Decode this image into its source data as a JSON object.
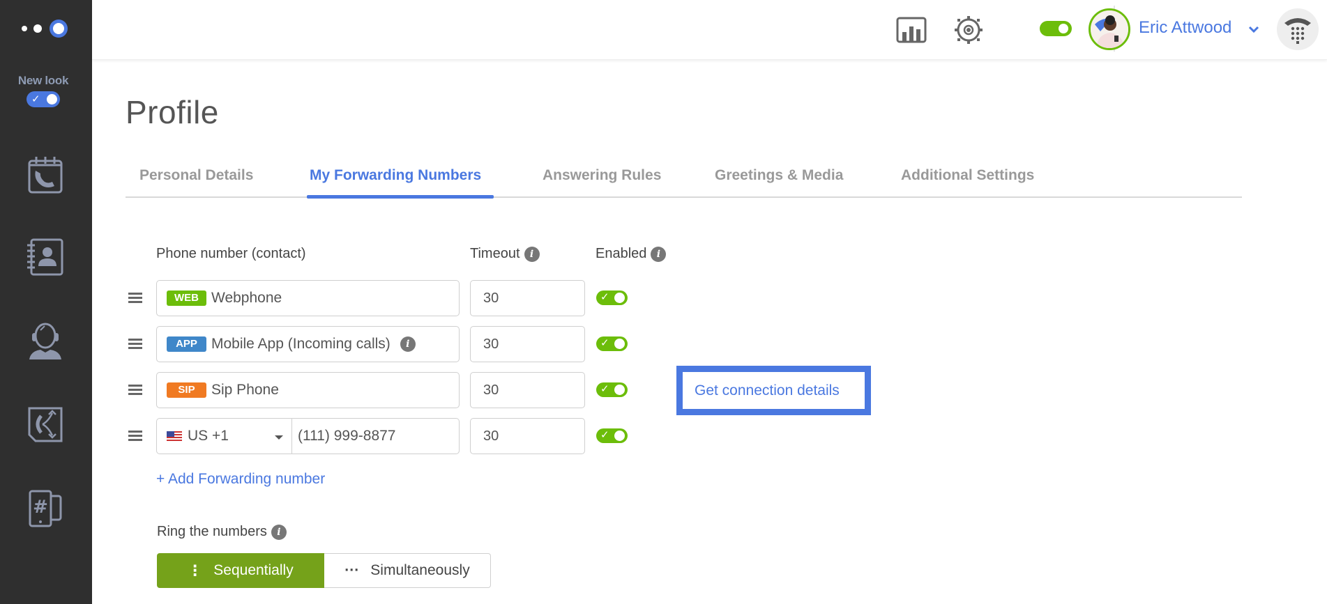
{
  "sidebar": {
    "new_look_label": "New look",
    "new_look_enabled": true,
    "items": [
      {
        "name": "call-history",
        "icon": "calendar-phone-icon"
      },
      {
        "name": "contacts",
        "icon": "address-book-icon"
      },
      {
        "name": "call-center",
        "icon": "headset-agent-icon"
      },
      {
        "name": "call-flow",
        "icon": "call-routing-icon"
      },
      {
        "name": "phone-numbers",
        "icon": "hash-devices-icon"
      }
    ]
  },
  "header": {
    "icons": [
      "bar-chart-icon",
      "gear-icon"
    ],
    "status_enabled": true,
    "user_name": "Eric Attwood",
    "dialer_icon": "dialpad-phone-icon"
  },
  "page": {
    "title": "Profile",
    "tabs": [
      {
        "label": "Personal Details",
        "active": false
      },
      {
        "label": "My Forwarding Numbers",
        "active": true
      },
      {
        "label": "Answering Rules",
        "active": false
      },
      {
        "label": "Greetings & Media",
        "active": false
      },
      {
        "label": "Additional Settings",
        "active": false
      }
    ]
  },
  "forwarding": {
    "columns": {
      "phone": "Phone number (contact)",
      "timeout": "Timeout",
      "enabled": "Enabled"
    },
    "rows": [
      {
        "badge": "WEB",
        "badge_color": "#6cbd0a",
        "label": "Webphone",
        "timeout": "30",
        "enabled": true,
        "info": false
      },
      {
        "badge": "APP",
        "badge_color": "#3f87c9",
        "label": "Mobile App (Incoming calls)",
        "timeout": "30",
        "enabled": true,
        "info": true
      },
      {
        "badge": "SIP",
        "badge_color": "#f07a22",
        "label": "Sip Phone",
        "timeout": "30",
        "enabled": true,
        "info": false
      },
      {
        "country": "US +1",
        "number": "(111) 999-8877",
        "timeout": "30",
        "enabled": true
      }
    ],
    "connection_details_label": "Get connection details",
    "add_label": "+ Add Forwarding number"
  },
  "ring": {
    "label": "Ring the numbers",
    "options": [
      {
        "label": "Sequentially",
        "selected": true
      },
      {
        "label": "Simultaneously",
        "selected": false
      }
    ]
  },
  "colors": {
    "accent": "#4a78e0",
    "green": "#6cbd0a",
    "segment_green": "#75a21a",
    "sidebar_bg": "#2f2f2f"
  }
}
